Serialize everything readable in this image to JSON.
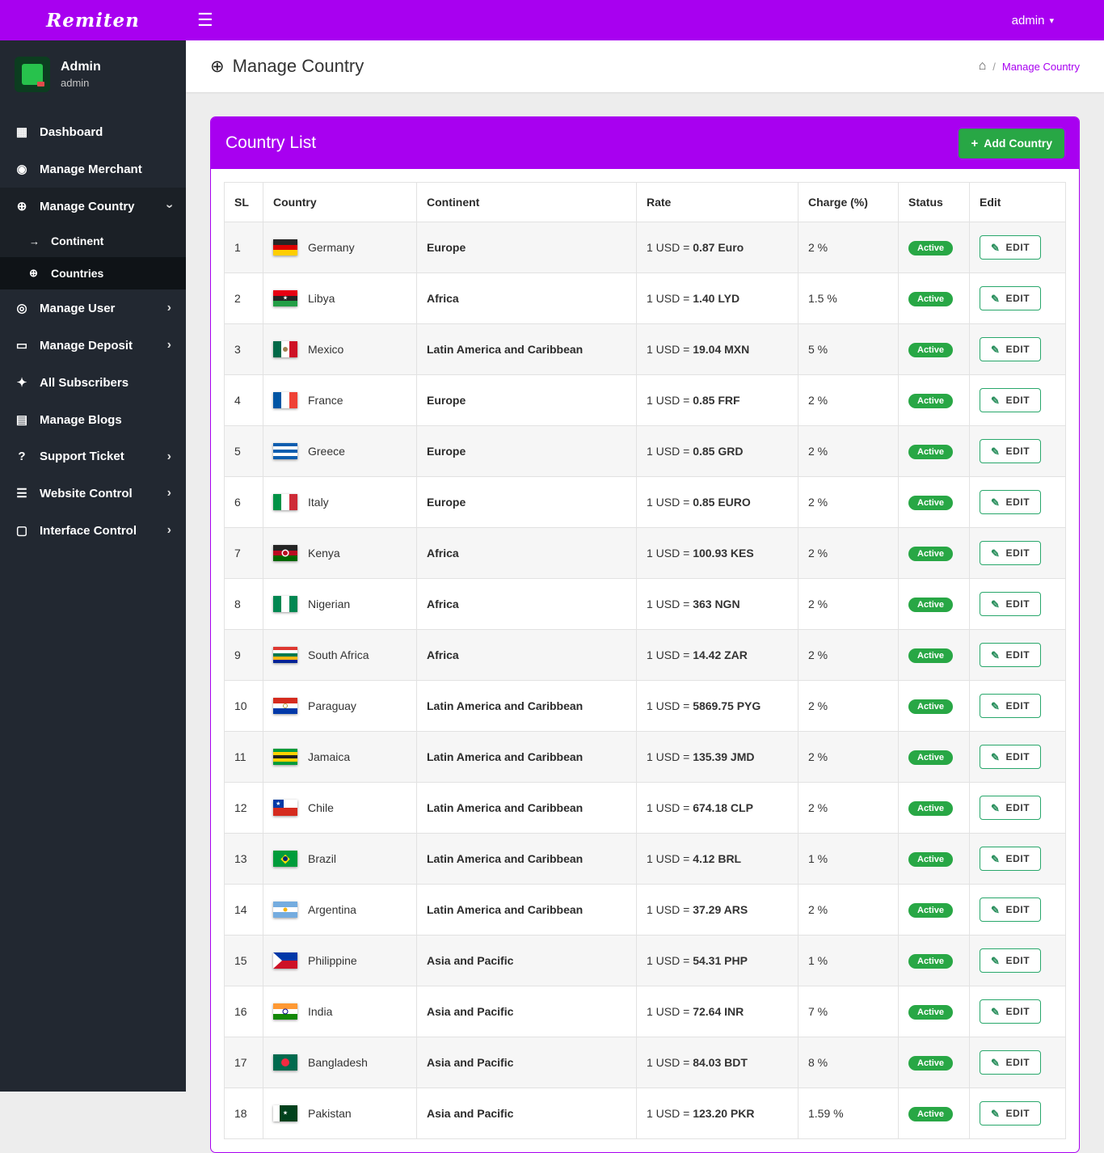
{
  "colors": {
    "purple": "#a800f0",
    "sidebar_bg": "#222831",
    "green_button": "#28a745",
    "badge_green": "#28a745",
    "edit_border": "#28a76b",
    "main_bg": "#ededed"
  },
  "icons": {
    "hamburger": "☰",
    "caret": "▾",
    "dashboard": "▦",
    "users": "◉",
    "globe": "⊕",
    "arrow": "→",
    "user": "◎",
    "card": "▭",
    "bell": "✦",
    "blog": "▤",
    "question": "?",
    "list": "☰",
    "desktop": "▢",
    "chevron": "›",
    "home": "⌂",
    "plus": "+",
    "pencil": "✎",
    "title_globe": "⊕"
  },
  "app": {
    "logo": "Remiten",
    "admin_label": "admin"
  },
  "sidebar": {
    "profile": {
      "name": "Admin",
      "subtitle": "admin"
    },
    "items": [
      {
        "id": "dashboard",
        "icon": "dashboard",
        "label": "Dashboard"
      },
      {
        "id": "manage-merchant",
        "icon": "users",
        "label": "Manage Merchant"
      },
      {
        "id": "manage-country",
        "icon": "globe",
        "label": "Manage Country",
        "active": true,
        "chevron": "down",
        "submenu": [
          {
            "id": "continent",
            "icon": "arrow",
            "label": "Continent"
          },
          {
            "id": "countries",
            "icon": "globe",
            "label": "Countries",
            "active": true
          }
        ]
      },
      {
        "id": "manage-user",
        "icon": "user",
        "label": "Manage User",
        "chevron": "right"
      },
      {
        "id": "manage-deposit",
        "icon": "card",
        "label": "Manage Deposit",
        "chevron": "right"
      },
      {
        "id": "all-subscribers",
        "icon": "bell",
        "label": "All Subscribers"
      },
      {
        "id": "manage-blogs",
        "icon": "blog",
        "label": "Manage Blogs"
      },
      {
        "id": "support-ticket",
        "icon": "question",
        "label": "Support Ticket",
        "chevron": "right"
      },
      {
        "id": "website-control",
        "icon": "list",
        "label": "Website Control",
        "chevron": "right"
      },
      {
        "id": "interface-control",
        "icon": "desktop",
        "label": "Interface Control",
        "chevron": "right"
      }
    ]
  },
  "page": {
    "title": "Manage Country",
    "breadcrumb_separator": "/",
    "breadcrumb_current": "Manage Country"
  },
  "card": {
    "title": "Country List",
    "add_button": "Add Country"
  },
  "table": {
    "columns": [
      "SL",
      "Country",
      "Continent",
      "Rate",
      "Charge (%)",
      "Status",
      "Edit"
    ],
    "rate_prefix": "1 USD =",
    "edit_label": "EDIT",
    "rows": [
      {
        "sl": "1",
        "country": "Germany",
        "continent": "Europe",
        "rate": "0.87 Euro",
        "charge": "2 %",
        "status": "Active",
        "flag": {
          "dir": "h",
          "stripes": [
            "#262626",
            "#dd0000",
            "#ffce00"
          ]
        }
      },
      {
        "sl": "2",
        "country": "Libya",
        "continent": "Africa",
        "rate": "1.40 LYD",
        "charge": "1.5 %",
        "status": "Active",
        "flag": {
          "dir": "h",
          "stripes": [
            "#e70013",
            "#242424",
            "#239e46"
          ],
          "overlays": [
            {
              "glyph": "★",
              "color": "#ffffff",
              "size": 7
            }
          ]
        }
      },
      {
        "sl": "3",
        "country": "Mexico",
        "continent": "Latin America and Caribbean",
        "rate": "19.04 MXN",
        "charge": "5 %",
        "status": "Active",
        "flag": {
          "dir": "v",
          "stripes": [
            "#006847",
            "#ffffff",
            "#ce1126"
          ],
          "overlays": [
            {
              "shape": "circle",
              "color": "#a08050",
              "size": 6
            }
          ]
        }
      },
      {
        "sl": "4",
        "country": "France",
        "continent": "Europe",
        "rate": "0.85 FRF",
        "charge": "2 %",
        "status": "Active",
        "flag": {
          "dir": "v",
          "stripes": [
            "#0055a4",
            "#ffffff",
            "#ef4135"
          ]
        }
      },
      {
        "sl": "5",
        "country": "Greece",
        "continent": "Europe",
        "rate": "0.85 GRD",
        "charge": "2 %",
        "status": "Active",
        "flag": {
          "dir": "h",
          "stripes": [
            "#0d5eaf",
            "#ffffff",
            "#0d5eaf",
            "#ffffff",
            "#0d5eaf"
          ]
        }
      },
      {
        "sl": "6",
        "country": "Italy",
        "continent": "Europe",
        "rate": "0.85 EURO",
        "charge": "2 %",
        "status": "Active",
        "flag": {
          "dir": "v",
          "stripes": [
            "#009246",
            "#ffffff",
            "#ce2b37"
          ]
        }
      },
      {
        "sl": "7",
        "country": "Kenya",
        "continent": "Africa",
        "rate": "100.93 KES",
        "charge": "2 %",
        "status": "Active",
        "flag": {
          "dir": "h",
          "stripes": [
            "#242424",
            "#bb0a21",
            "#006600"
          ],
          "overlays": [
            {
              "shape": "circle",
              "color": "#ffffff",
              "size": 9
            },
            {
              "shape": "circle",
              "color": "#bb0a21",
              "size": 6
            }
          ]
        }
      },
      {
        "sl": "8",
        "country": "Nigerian",
        "continent": "Africa",
        "rate": "363 NGN",
        "charge": "2 %",
        "status": "Active",
        "flag": {
          "dir": "v",
          "stripes": [
            "#008751",
            "#ffffff",
            "#008751"
          ]
        }
      },
      {
        "sl": "9",
        "country": "South Africa",
        "continent": "Africa",
        "rate": "14.42 ZAR",
        "charge": "2 %",
        "status": "Active",
        "flag": {
          "dir": "h",
          "stripes": [
            "#de3831",
            "#ffffff",
            "#007a4d",
            "#ffb612",
            "#002395"
          ]
        }
      },
      {
        "sl": "10",
        "country": "Paraguay",
        "continent": "Latin America and Caribbean",
        "rate": "5869.75 PYG",
        "charge": "2 %",
        "status": "Active",
        "flag": {
          "dir": "h",
          "stripes": [
            "#d52b1e",
            "#ffffff",
            "#0038a8"
          ],
          "overlays": [
            {
              "shape": "ring",
              "color": "#b0a040",
              "size": 6
            }
          ]
        }
      },
      {
        "sl": "11",
        "country": "Jamaica",
        "continent": "Latin America and Caribbean",
        "rate": "135.39 JMD",
        "charge": "2 %",
        "status": "Active",
        "flag": {
          "dir": "h",
          "stripes": [
            "#009b3a",
            "#fed100",
            "#1f1f1f",
            "#fed100",
            "#009b3a"
          ]
        }
      },
      {
        "sl": "12",
        "country": "Chile",
        "continent": "Latin America and Caribbean",
        "rate": "674.18 CLP",
        "charge": "2 %",
        "status": "Active",
        "flag": {
          "dir": "h",
          "stripes": [
            "#ffffff",
            "#d52b1e"
          ],
          "canton": {
            "color": "#0039a6",
            "glyph": "★",
            "glyph_color": "#ffffff"
          }
        }
      },
      {
        "sl": "13",
        "country": "Brazil",
        "continent": "Latin America and Caribbean",
        "rate": "4.12 BRL",
        "charge": "1 %",
        "status": "Active",
        "flag": {
          "dir": "h",
          "stripes": [
            "#009c3b"
          ],
          "overlays": [
            {
              "glyph": "◆",
              "color": "#ffdf00",
              "size": 15
            },
            {
              "shape": "circle",
              "color": "#002776",
              "size": 6
            }
          ]
        }
      },
      {
        "sl": "14",
        "country": "Argentina",
        "continent": "Latin America and Caribbean",
        "rate": "37.29 ARS",
        "charge": "2 %",
        "status": "Active",
        "flag": {
          "dir": "h",
          "stripes": [
            "#74acdf",
            "#ffffff",
            "#74acdf"
          ],
          "overlays": [
            {
              "shape": "circle",
              "color": "#f6b40e",
              "size": 5
            }
          ]
        }
      },
      {
        "sl": "15",
        "country": "Philippine",
        "continent": "Asia and Pacific",
        "rate": "54.31 PHP",
        "charge": "1 %",
        "status": "Active",
        "flag": {
          "dir": "h",
          "stripes": [
            "#0038a8",
            "#ce1126"
          ],
          "overlays": [
            {
              "shape": "triangle",
              "color": "#ffffff"
            }
          ]
        }
      },
      {
        "sl": "16",
        "country": "India",
        "continent": "Asia and Pacific",
        "rate": "72.64 INR",
        "charge": "7 %",
        "status": "Active",
        "flag": {
          "dir": "h",
          "stripes": [
            "#ff9933",
            "#ffffff",
            "#138808"
          ],
          "overlays": [
            {
              "shape": "ring",
              "color": "#000088",
              "size": 7
            }
          ]
        }
      },
      {
        "sl": "17",
        "country": "Bangladesh",
        "continent": "Asia and Pacific",
        "rate": "84.03 BDT",
        "charge": "8 %",
        "status": "Active",
        "flag": {
          "dir": "h",
          "stripes": [
            "#006a4e"
          ],
          "overlays": [
            {
              "shape": "circle",
              "color": "#f42a41",
              "size": 10
            }
          ]
        }
      },
      {
        "sl": "18",
        "country": "Pakistan",
        "continent": "Asia and Pacific",
        "rate": "123.20 PKR",
        "charge": "1.59 %",
        "status": "Active",
        "flag": {
          "dir": "v",
          "stripes": [
            "#ffffff",
            "#01411c",
            "#01411c",
            "#01411c"
          ],
          "overlays": [
            {
              "glyph": "★",
              "color": "#ffffff",
              "size": 7
            }
          ]
        }
      }
    ]
  }
}
